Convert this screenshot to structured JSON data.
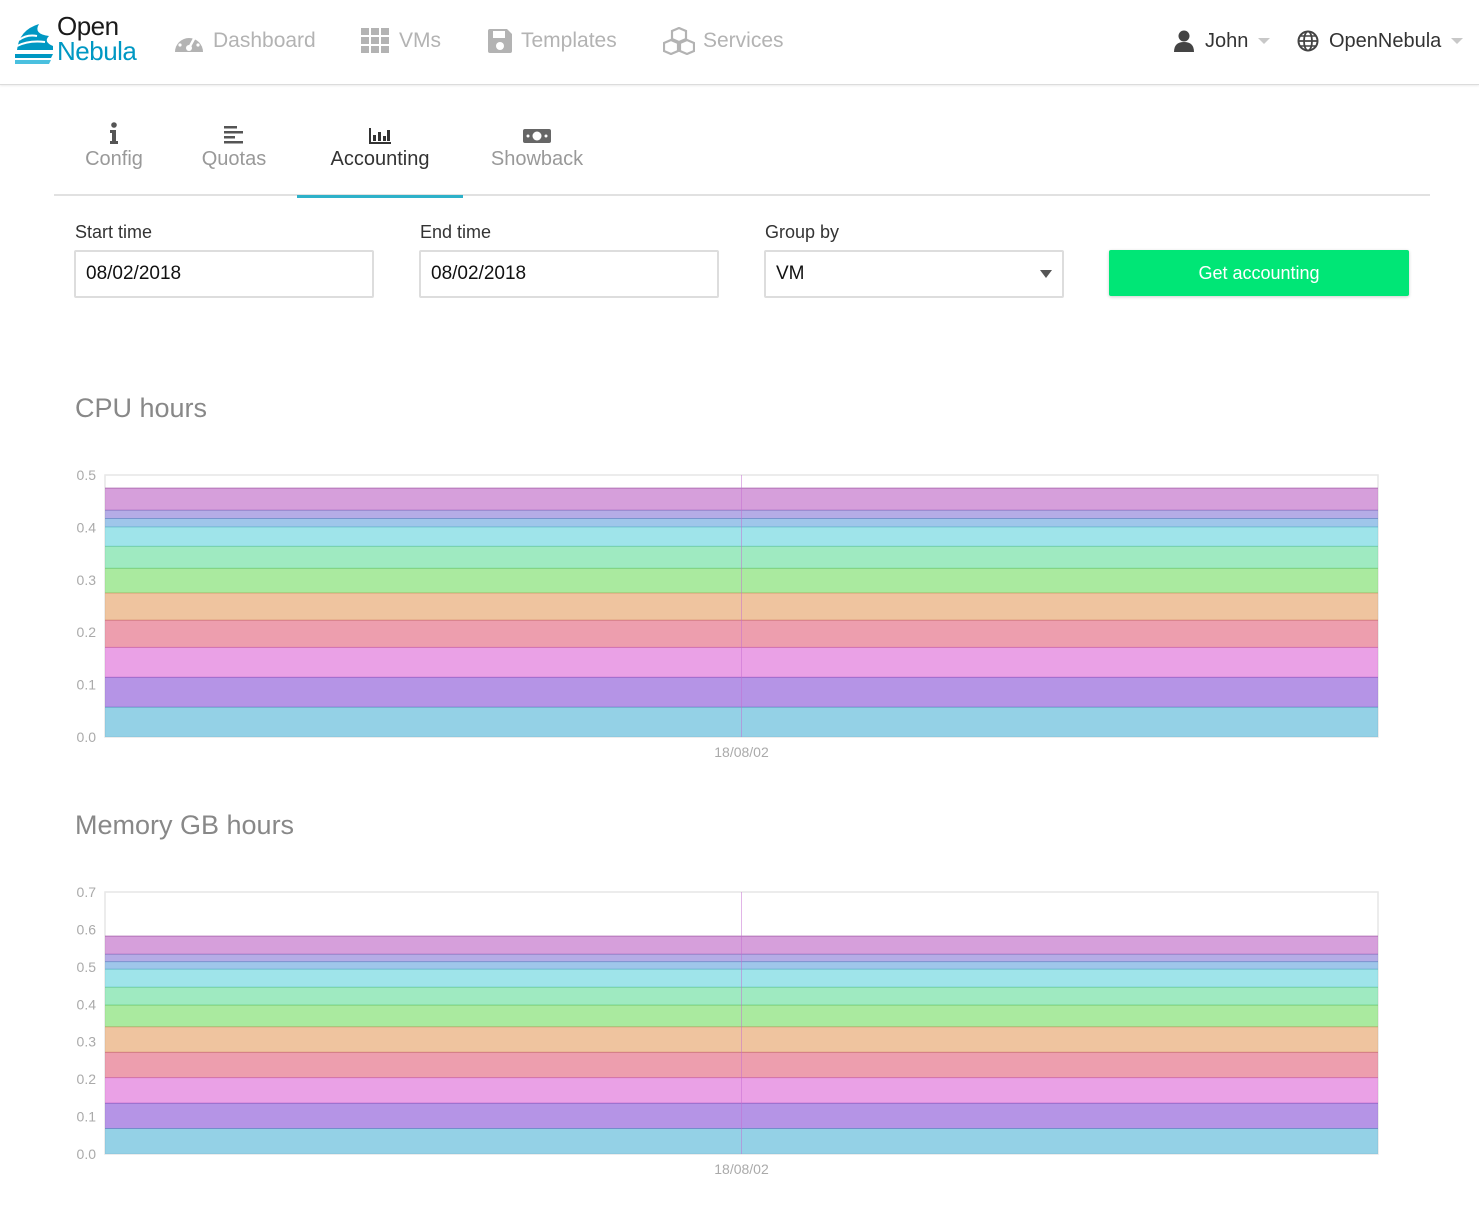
{
  "app": {
    "logo_line1": "Open",
    "logo_line2": "Nebula"
  },
  "nav": {
    "items": [
      {
        "label": "Dashboard",
        "icon": "dashboard-icon"
      },
      {
        "label": "VMs",
        "icon": "grid-icon"
      },
      {
        "label": "Templates",
        "icon": "save-icon"
      },
      {
        "label": "Services",
        "icon": "cubes-icon"
      }
    ],
    "user": {
      "label": "John",
      "icon": "user-icon"
    },
    "zone": {
      "label": "OpenNebula",
      "icon": "globe-icon"
    }
  },
  "tabs": [
    {
      "label": "Config",
      "icon": "info-icon",
      "active": false
    },
    {
      "label": "Quotas",
      "icon": "align-left-icon",
      "active": false
    },
    {
      "label": "Accounting",
      "icon": "bar-chart-icon",
      "active": true
    },
    {
      "label": "Showback",
      "icon": "money-icon",
      "active": false
    }
  ],
  "form": {
    "start_label": "Start time",
    "start_value": "08/02/2018",
    "end_label": "End time",
    "end_value": "08/02/2018",
    "group_label": "Group by",
    "group_value": "VM",
    "submit_label": "Get accounting"
  },
  "colors": {
    "accent": "#2db1c9",
    "button": "#00e676",
    "brand": "#0098c3"
  },
  "chart_data": [
    {
      "type": "area",
      "title": "CPU hours",
      "x": [
        "18/08/02"
      ],
      "ylim": [
        0,
        0.5
      ],
      "yticks": [
        "0.0",
        "0.1",
        "0.2",
        "0.3",
        "0.4",
        "0.5"
      ],
      "stacked": true,
      "series": [
        {
          "values": [
            0.057
          ],
          "color": "#5bb8d8"
        },
        {
          "values": [
            0.057
          ],
          "color": "#8e5bd8"
        },
        {
          "values": [
            0.057
          ],
          "color": "#de6fd8"
        },
        {
          "values": [
            0.052
          ],
          "color": "#e36a82"
        },
        {
          "values": [
            0.052
          ],
          "color": "#e6a56c"
        },
        {
          "values": [
            0.047
          ],
          "color": "#7ddf6c"
        },
        {
          "values": [
            0.042
          ],
          "color": "#6cdfa0"
        },
        {
          "values": [
            0.037
          ],
          "color": "#6cd6df"
        },
        {
          "values": [
            0.016
          ],
          "color": "#6ca8df"
        },
        {
          "values": [
            0.016
          ],
          "color": "#8e7fd8"
        },
        {
          "values": [
            0.042
          ],
          "color": "#c06cc7"
        }
      ]
    },
    {
      "type": "area",
      "title": "Memory GB hours",
      "x": [
        "18/08/02"
      ],
      "ylim": [
        0,
        0.7
      ],
      "yticks": [
        "0.0",
        "0.1",
        "0.2",
        "0.3",
        "0.4",
        "0.5",
        "0.6",
        "0.7"
      ],
      "stacked": true,
      "series": [
        {
          "values": [
            0.068
          ],
          "color": "#5bb8d8"
        },
        {
          "values": [
            0.068
          ],
          "color": "#8e5bd8"
        },
        {
          "values": [
            0.068
          ],
          "color": "#de6fd8"
        },
        {
          "values": [
            0.068
          ],
          "color": "#e36a82"
        },
        {
          "values": [
            0.068
          ],
          "color": "#e6a56c"
        },
        {
          "values": [
            0.058
          ],
          "color": "#7ddf6c"
        },
        {
          "values": [
            0.048
          ],
          "color": "#6cdfa0"
        },
        {
          "values": [
            0.048
          ],
          "color": "#6cd6df"
        },
        {
          "values": [
            0.02
          ],
          "color": "#6ca8df"
        },
        {
          "values": [
            0.02
          ],
          "color": "#8e7fd8"
        },
        {
          "values": [
            0.048
          ],
          "color": "#c06cc7"
        }
      ]
    }
  ]
}
